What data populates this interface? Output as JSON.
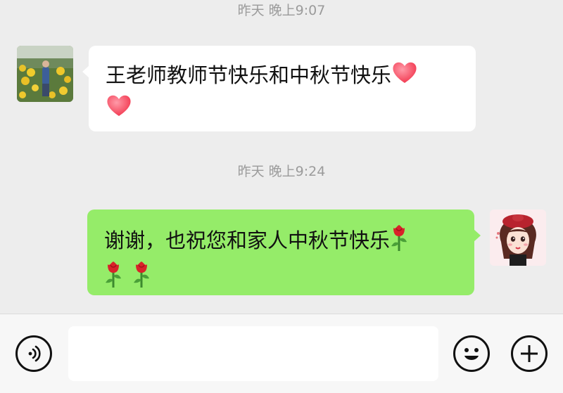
{
  "messages": [
    {
      "timestamp": "昨天 晚上9:07",
      "direction": "incoming",
      "text": "王老师教师节快乐和中秋节快乐",
      "emojis": [
        "heart",
        "heart"
      ]
    },
    {
      "timestamp": "昨天 晚上9:24",
      "direction": "outgoing",
      "text": "谢谢，也祝您和家人中秋节快乐",
      "emojis": [
        "rose",
        "rose",
        "rose"
      ]
    }
  ],
  "input_bar": {
    "voice_icon": "voice-icon",
    "text_value": "",
    "emoji_icon": "smiley-face-icon",
    "more_icon": "plus-icon"
  },
  "colors": {
    "chat_background": "#ededed",
    "incoming_bubble": "#ffffff",
    "outgoing_bubble": "#95ec69",
    "timestamp_text": "#9b9b9b",
    "input_bar_background": "#f7f7f7"
  }
}
